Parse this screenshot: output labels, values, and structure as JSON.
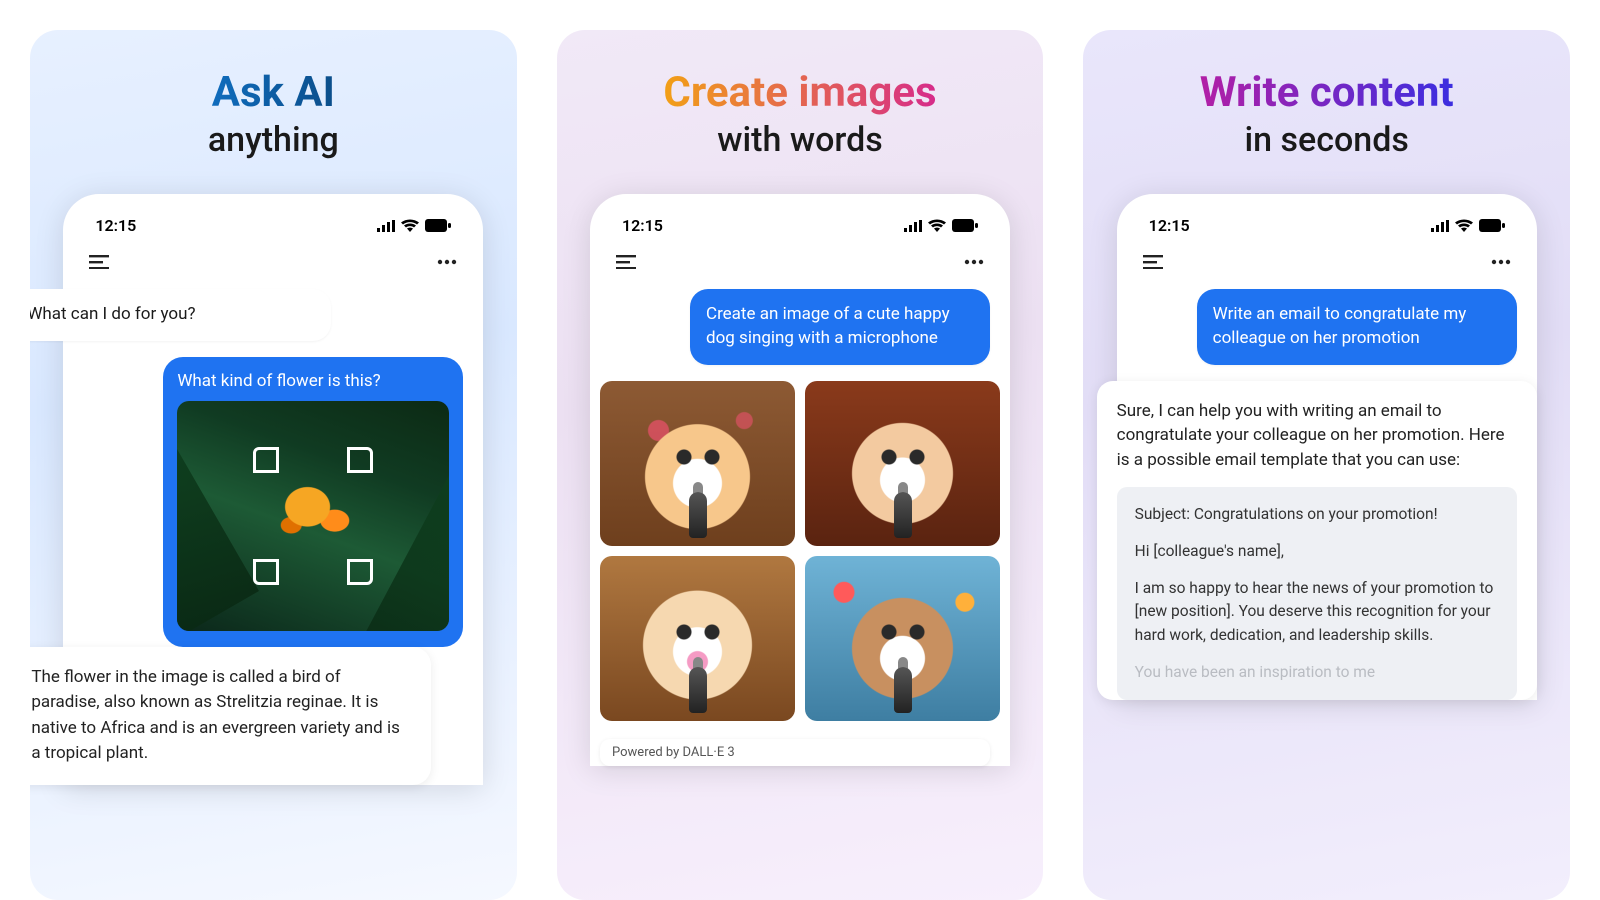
{
  "shared": {
    "time": "12:15"
  },
  "panel1": {
    "headline": "Ask AI",
    "subline": "anything",
    "ai_intro": "What can I do for you?",
    "user_q": "What kind of flower is this?",
    "ai_answer": "The flower in the image is called a bird of paradise, also known as Strelitzia reginae. It is native to Africa and is an evergreen variety and is a tropical plant."
  },
  "panel2": {
    "headline": "Create images",
    "subline": "with words",
    "user_prompt": "Create an image of a cute happy dog singing with a microphone",
    "powered_by": "Powered by DALL·E 3"
  },
  "panel3": {
    "headline": "Write content",
    "subline": "in seconds",
    "user_prompt": "Write an email to congratulate my colleague on her promotion",
    "ai_intro": "Sure, I can help you with writing an email to congratulate your colleague on her promotion. Here is a possible email template that you can use:",
    "email_subject": "Subject: Congratulations on your promotion!",
    "email_greeting": "Hi [colleague's name],",
    "email_body1": "I am so happy to hear the news of your promotion to [new position]. You deserve this recognition for your hard work, dedication, and leadership skills.",
    "email_body2": "You have been an inspiration to me"
  }
}
